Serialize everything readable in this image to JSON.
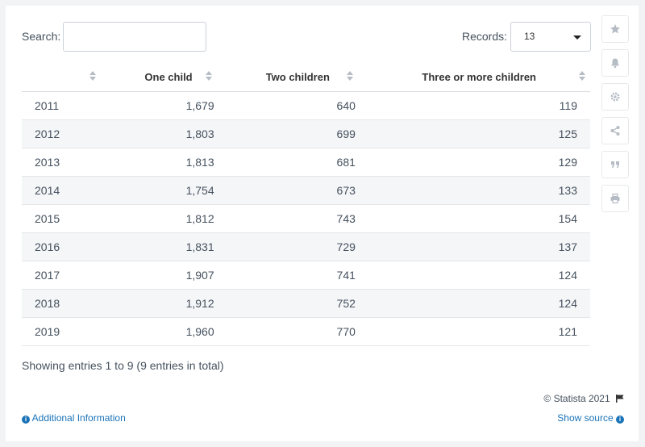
{
  "search": {
    "label": "Search:",
    "value": ""
  },
  "records": {
    "label": "Records:",
    "value": "13"
  },
  "table": {
    "headers": [
      "",
      "One child",
      "Two children",
      "Three or more children"
    ],
    "rows": [
      [
        "2011",
        "1,679",
        "640",
        "119"
      ],
      [
        "2012",
        "1,803",
        "699",
        "125"
      ],
      [
        "2013",
        "1,813",
        "681",
        "129"
      ],
      [
        "2014",
        "1,754",
        "673",
        "133"
      ],
      [
        "2015",
        "1,812",
        "743",
        "154"
      ],
      [
        "2016",
        "1,831",
        "729",
        "137"
      ],
      [
        "2017",
        "1,907",
        "741",
        "124"
      ],
      [
        "2018",
        "1,912",
        "752",
        "124"
      ],
      [
        "2019",
        "1,960",
        "770",
        "121"
      ]
    ]
  },
  "chart_data": {
    "type": "table",
    "categories": [
      "2011",
      "2012",
      "2013",
      "2014",
      "2015",
      "2016",
      "2017",
      "2018",
      "2019"
    ],
    "series": [
      {
        "name": "One child",
        "values": [
          1679,
          1803,
          1813,
          1754,
          1812,
          1831,
          1907,
          1912,
          1960
        ]
      },
      {
        "name": "Two children",
        "values": [
          640,
          699,
          681,
          673,
          743,
          729,
          741,
          752,
          770
        ]
      },
      {
        "name": "Three or more children",
        "values": [
          119,
          125,
          129,
          133,
          154,
          137,
          124,
          124,
          121
        ]
      }
    ]
  },
  "footer": {
    "entries": "Showing entries 1 to 9 (9 entries in total)",
    "copyright": "© Statista 2021",
    "additional_info": "Additional Information",
    "show_source": "Show source"
  },
  "sidebar": [
    "star-icon",
    "bell-icon",
    "gear-icon",
    "share-icon",
    "quote-icon",
    "print-icon"
  ]
}
